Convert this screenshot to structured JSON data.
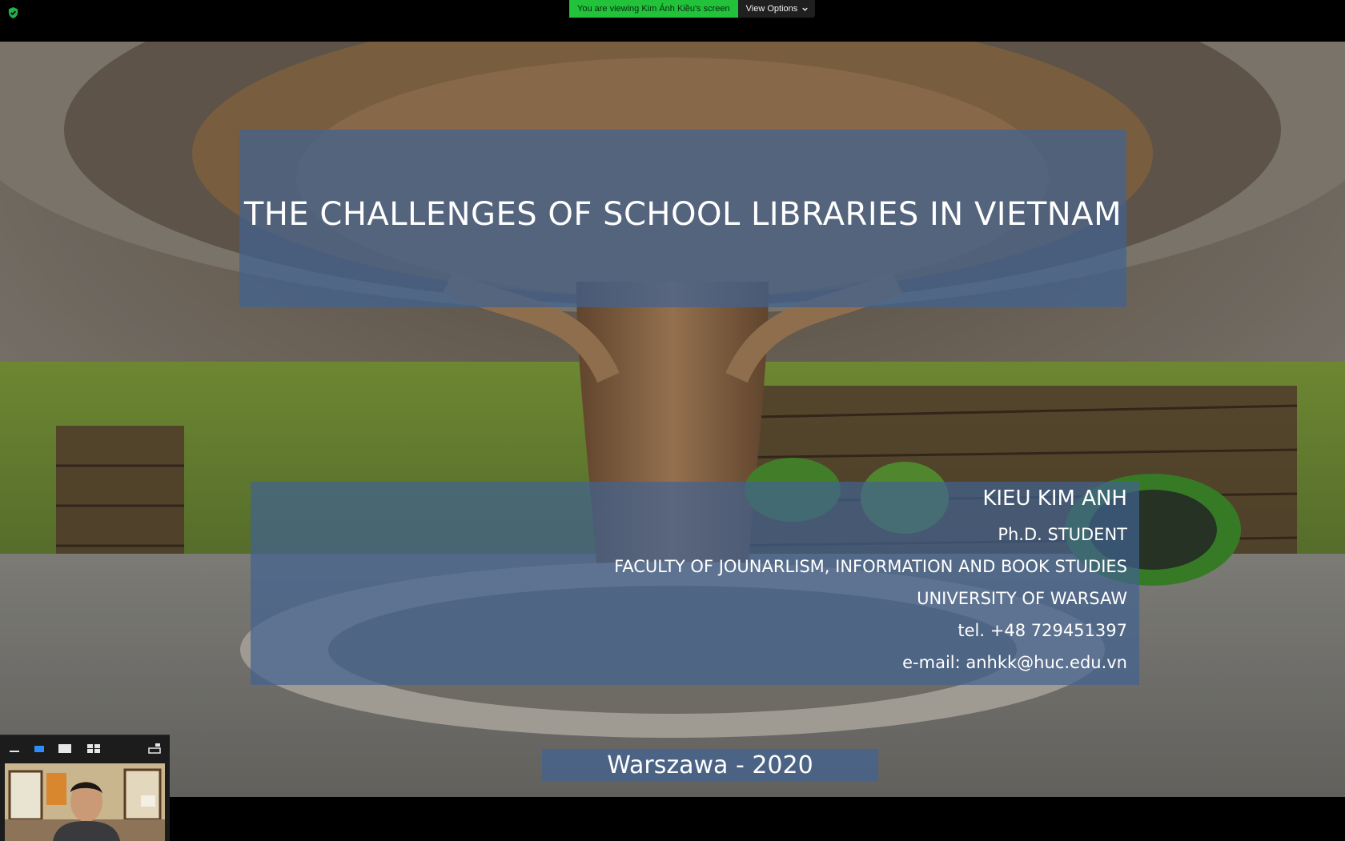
{
  "banner": {
    "viewing_text": "You are viewing Kim Ánh Kiều's screen",
    "view_options_label": "View Options",
    "accent_color": "#22c33a"
  },
  "slide": {
    "title": "THE CHALLENGES OF SCHOOL LIBRARIES IN VIETNAM",
    "author_name": "KIEU KIM ANH",
    "author_role": "Ph.D. STUDENT",
    "faculty": "FACULTY OF JOUNARLISM, INFORMATION AND BOOK STUDIES",
    "university": "UNIVERSITY OF WARSAW",
    "phone": "tel. +48 729451397",
    "email": "e-mail: anhkk@huc.edu.vn",
    "footer": "Warszawa - 2020"
  },
  "video_panel": {
    "buttons": [
      "minimize-icon",
      "speaker-view-icon",
      "active-speaker-icon",
      "gallery-view-icon",
      "exit-panel-icon"
    ]
  },
  "icons": {
    "encryption": "shield-check-icon"
  }
}
